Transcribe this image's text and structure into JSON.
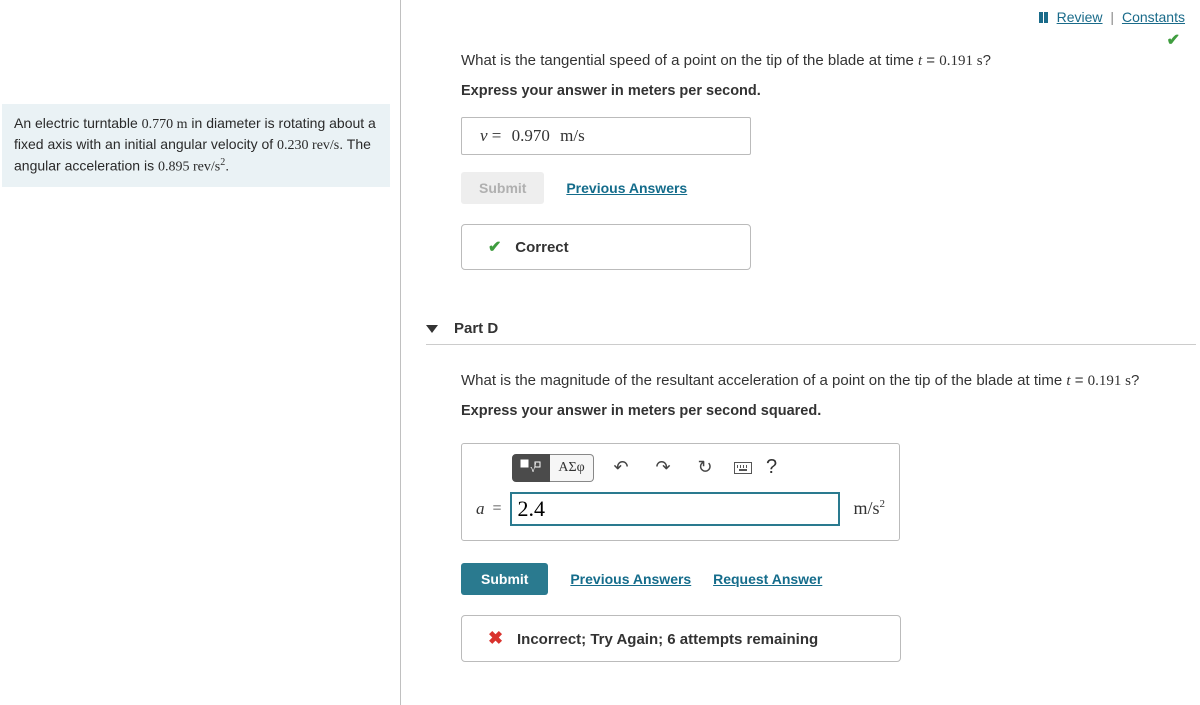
{
  "top_links": {
    "review": "Review",
    "constants": "Constants"
  },
  "left_panel": {
    "problem_html": "An electric turntable 0.770 m in diameter is rotating about a fixed axis with an initial angular velocity of 0.230 rev/s. The angular acceleration is 0.895 rev/s²."
  },
  "part_c": {
    "question": "What is the tangential speed of a point on the tip of the blade at time t = 0.191 s?",
    "instruction": "Express your answer in meters per second.",
    "var": "v",
    "value": "0.970",
    "unit": "m/s",
    "submit_label": "Submit",
    "prev_answers": "Previous Answers",
    "feedback": "Correct"
  },
  "part_d": {
    "header": "Part D",
    "question": "What is the magnitude of the resultant acceleration of a point on the tip of the blade at time t = 0.191 s?",
    "instruction": "Express your answer in meters per second squared.",
    "toolbar": {
      "math_symbol": "ΑΣφ"
    },
    "var": "a",
    "value": "2.4",
    "unit": "m/s²",
    "submit_label": "Submit",
    "prev_answers": "Previous Answers",
    "request_answer": "Request Answer",
    "feedback": "Incorrect; Try Again; 6 attempts remaining"
  }
}
